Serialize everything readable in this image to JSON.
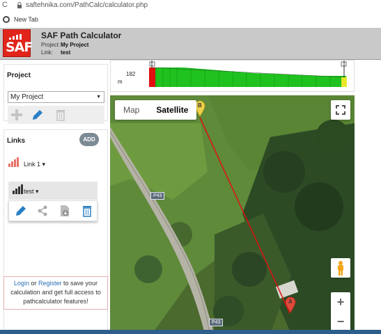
{
  "browser": {
    "url": "saftehnika.com/PathCalc/calculator.php",
    "bookmark": "New Tab"
  },
  "header": {
    "logo_text": "SAF",
    "title": "SAF Path Calculator",
    "project_key": "Project:",
    "project_value": "My Project",
    "link_key": "Link:",
    "link_value": "test"
  },
  "project_panel": {
    "title": "Project",
    "selected": "My Project",
    "tools": [
      "add-icon",
      "edit-icon",
      "delete-icon"
    ]
  },
  "links_panel": {
    "title": "Links",
    "add_label": "ADD",
    "items": [
      {
        "name": "Link 1",
        "signal_color": "#e8726a"
      },
      {
        "name": "test",
        "signal_color": "#333333"
      }
    ],
    "tools": [
      "edit-icon",
      "share-icon",
      "export-icon",
      "delete-icon"
    ]
  },
  "login": {
    "login_text": "Login",
    "or_text": "or",
    "register_text": "Register",
    "rest_text": "to save your calculation and get full access to pathcalculator features!"
  },
  "profile": {
    "value": "182",
    "unit": "m"
  },
  "map": {
    "type_map": "Map",
    "type_satellite": "Satellite",
    "road_label": "P43",
    "marker_a": "A",
    "marker_b": "B",
    "zoom_in": "+",
    "zoom_out": "−",
    "colors": {
      "path_line": "#e01010",
      "terrain": "#1fc21f",
      "marker_a": "#e04a3a",
      "marker_b": "#f0d24a"
    }
  }
}
